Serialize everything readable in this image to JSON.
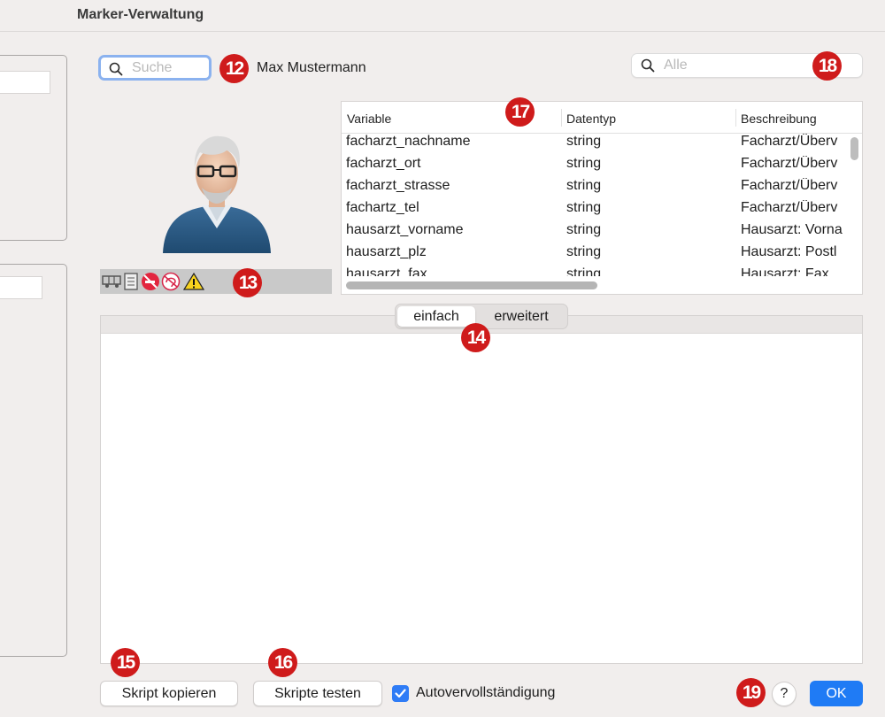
{
  "window": {
    "title": "Marker-Verwaltung"
  },
  "search": {
    "placeholder": "Suche",
    "icon": "search-icon"
  },
  "patient": {
    "name": "Max Mustermann"
  },
  "filter": {
    "placeholder": "Alle",
    "icon": "search-icon"
  },
  "badges": {
    "b12": "12",
    "b13": "13",
    "b14": "14",
    "b15": "15",
    "b16": "16",
    "b17": "17",
    "b18": "18",
    "b19": "19",
    "color": "#cf1b1b"
  },
  "status_icons": [
    "vehicle-icon",
    "clipboard-icon",
    "no-smoking-icon",
    "hearing-impaired-icon",
    "warning-icon"
  ],
  "table": {
    "headers": [
      "Variable",
      "Datentyp",
      "Beschreibung"
    ],
    "rows": [
      [
        "facharzt_nachname",
        "string",
        "Facharzt/Überv"
      ],
      [
        "facharzt_ort",
        "string",
        "Facharzt/Überv"
      ],
      [
        "facharzt_strasse",
        "string",
        "Facharzt/Überv"
      ],
      [
        "fachartz_tel",
        "string",
        "Facharzt/Überv"
      ],
      [
        "hausarzt_vorname",
        "string",
        "Hausarzt: Vorna"
      ],
      [
        "hausarzt_plz",
        "string",
        "Hausarzt: Postl"
      ],
      [
        "hausarzt_fax",
        "string",
        "Hausarzt: Fax"
      ]
    ]
  },
  "tabs": {
    "simple": "einfach",
    "advanced": "erweitert",
    "active": "einfach"
  },
  "buttons": {
    "copy_script": "Skript kopieren",
    "test_scripts": "Skripte testen",
    "help": "?",
    "ok": "OK"
  },
  "autocomplete": {
    "label": "Autovervollständigung",
    "checked": true
  },
  "colors": {
    "accent": "#1f7bf5",
    "checkbox": "#2f7cf6",
    "badge": "#cf1b1b"
  }
}
